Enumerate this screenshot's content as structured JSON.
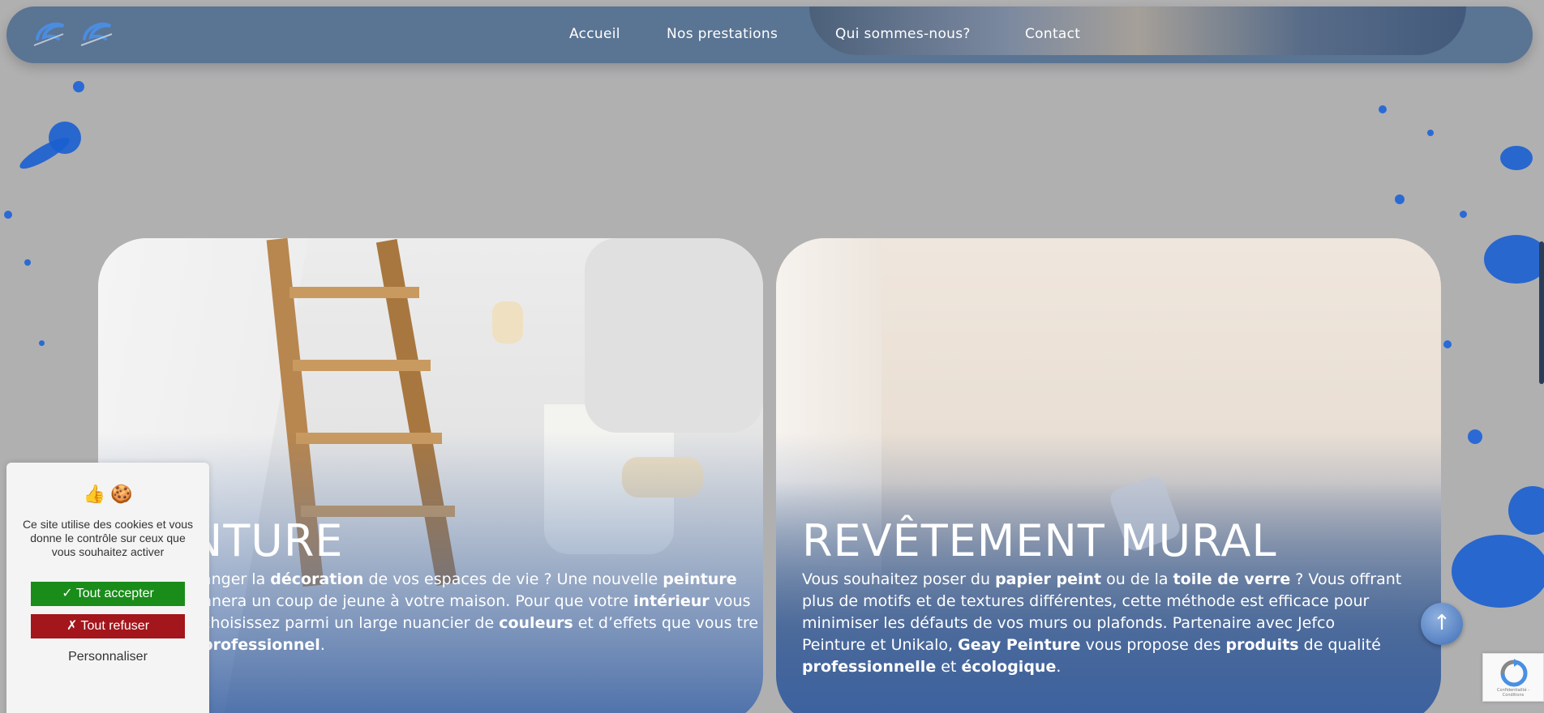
{
  "header": {
    "nav": [
      {
        "label": "Accueil"
      },
      {
        "label": "Nos prestations"
      },
      {
        "label": "Qui sommes-nous?"
      },
      {
        "label": "Contact"
      }
    ]
  },
  "cards": [
    {
      "title": "INTURE",
      "text_parts": [
        {
          "t": "anger la ",
          "b": false
        },
        {
          "t": "décoration",
          "b": true
        },
        {
          "t": " de vos espaces de vie ? Une nouvelle ",
          "b": false
        },
        {
          "t": "peinture",
          "b": true
        },
        {
          "t": " nnera un coup de jeune à votre maison. Pour que votre ",
          "b": false
        },
        {
          "t": "intérieur",
          "b": true
        },
        {
          "t": " vous choisissez parmi un large nuancier de ",
          "b": false
        },
        {
          "t": "couleurs",
          "b": true
        },
        {
          "t": " et d’effets que vous tre ",
          "b": false
        },
        {
          "t": "professionnel",
          "b": true
        },
        {
          "t": ".",
          "b": false
        }
      ]
    },
    {
      "title": "REVÊTEMENT MURAL",
      "text_parts": [
        {
          "t": "Vous souhaitez poser du ",
          "b": false
        },
        {
          "t": "papier peint",
          "b": true
        },
        {
          "t": " ou de la ",
          "b": false
        },
        {
          "t": "toile de verre",
          "b": true
        },
        {
          "t": " ? Vous offrant plus de motifs et de textures différentes, cette méthode est efficace pour minimiser les défauts de vos murs ou plafonds. Partenaire avec Jefco Peinture et Unikalo, ",
          "b": false
        },
        {
          "t": "Geay Peinture",
          "b": true
        },
        {
          "t": " vous propose des ",
          "b": false
        },
        {
          "t": "produits",
          "b": true
        },
        {
          "t": " de qualité ",
          "b": false
        },
        {
          "t": "professionnelle",
          "b": true
        },
        {
          "t": " et ",
          "b": false
        },
        {
          "t": "écologique",
          "b": true
        },
        {
          "t": ".",
          "b": false
        }
      ]
    }
  ],
  "cookie": {
    "icons": "👍 🍪",
    "message": "Ce site utilise des cookies et vous donne le contrôle sur ceux que vous souhaitez activer",
    "accept": "✓ Tout accepter",
    "refuse": "✗ Tout refuser",
    "customize": "Personnaliser"
  },
  "scroll_top": {
    "glyph": "↑"
  },
  "recaptcha": {
    "small_text": "Confidentialité - Conditions"
  },
  "colors": {
    "accent": "#5a7493",
    "accept": "#1a8c1a",
    "refuse": "#a3161c",
    "splatter": "#1a5fd0"
  }
}
